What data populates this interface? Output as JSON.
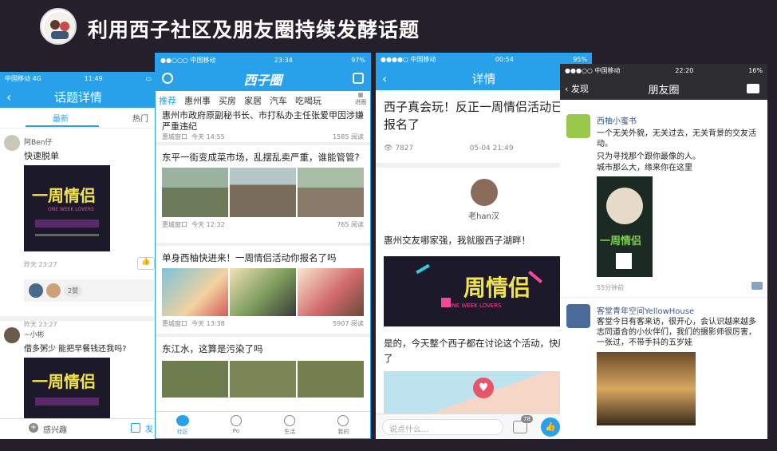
{
  "slide": {
    "title": "利用西子社区及朋友圈持续发酵话题"
  },
  "colors": {
    "accent": "#29a0ea",
    "background": "#241f2b",
    "poster": "#1c1a2a",
    "poster_text": "#f2e44a"
  },
  "p1": {
    "status": {
      "carrier": "中国移动  4G",
      "time": "11:49"
    },
    "nav_title": "话题详情",
    "tabs": {
      "latest": "最新",
      "hot": "热门"
    },
    "post1": {
      "user": "阿Ben仔",
      "text": "快速脱单",
      "time": "昨天 23:27",
      "likes": "2赞"
    },
    "post2": {
      "user": "~小彬",
      "text": "借多粥少  能把早餐钱还我吗?"
    },
    "poster": {
      "title": "一周情侣",
      "en": "ONE WEEK LOVERS"
    },
    "bottom": {
      "interest": "感兴趣",
      "post": "发"
    }
  },
  "p2": {
    "status": {
      "carrier": "●●○○○ 中国移动",
      "time": "23:34",
      "battery": "97%"
    },
    "logo": "西子圈",
    "tabs": [
      "推荐",
      "惠州事",
      "买房",
      "家居",
      "汽车",
      "吃喝玩"
    ],
    "more": "进圈",
    "items": [
      {
        "title": "惠州市政府原副秘书长、市打私办主任张爱甲因涉嫌严重违纪",
        "source": "惠城窗口",
        "time": "今天 14:55",
        "reads": "1585 阅读"
      },
      {
        "title": "东平一街变成菜市场，乱摆乱卖严重，谁能管管?",
        "source": "惠城窗口",
        "time": "今天 12:32",
        "reads": "765 阅读"
      },
      {
        "title": "单身西柚快进来！一周情侣活动你报名了吗",
        "source": "惠城窗口",
        "time": "今天 13:38",
        "reads": "5907 阅读"
      },
      {
        "title": "东江水，这算是污染了吗"
      }
    ],
    "bottom_nav": [
      "社区",
      "Po",
      "生活",
      "我的"
    ]
  },
  "p3": {
    "status": {
      "carrier": "●●●●○ 中国移动",
      "time": "00:54",
      "battery": "95%"
    },
    "nav_title": "详情",
    "title": "西子真会玩！反正一周情侣活动已经报名了",
    "views": "7827",
    "date": "05-04 21:49",
    "area": "惠城",
    "author": "老han汉",
    "para1": "惠州交友哪家强，我就服西子湖畔！",
    "para2": "是的，今天整个西子都在讨论这个活动，快刷屏了",
    "poster": {
      "title": "周情侣",
      "en": "ONE WEEK LOVERS"
    },
    "comment_placeholder": "说点什么...",
    "comment_count": "78"
  },
  "p4": {
    "status": {
      "carrier": "●●●○○ 中国移动",
      "time": "22:20",
      "battery": "16%"
    },
    "back": "发现",
    "nav_title": "朋友圈",
    "post1": {
      "user": "西柚小蜜书",
      "lines": [
        "一个无关外貌，无关过去，无关背景的交友活动。",
        "只为寻找那个跟你最像的人。",
        "城市那么大，缘来你在这里"
      ],
      "poster": "一周情侣",
      "time": "55分钟前"
    },
    "post2": {
      "user": "客堂青年空间YellowHouse",
      "text": "客堂今日有客来访，很开心，会认识越来越多志同道合的小伙伴们，我们的摄影师很厉害，一张过，不带手抖的五岁娃"
    }
  }
}
